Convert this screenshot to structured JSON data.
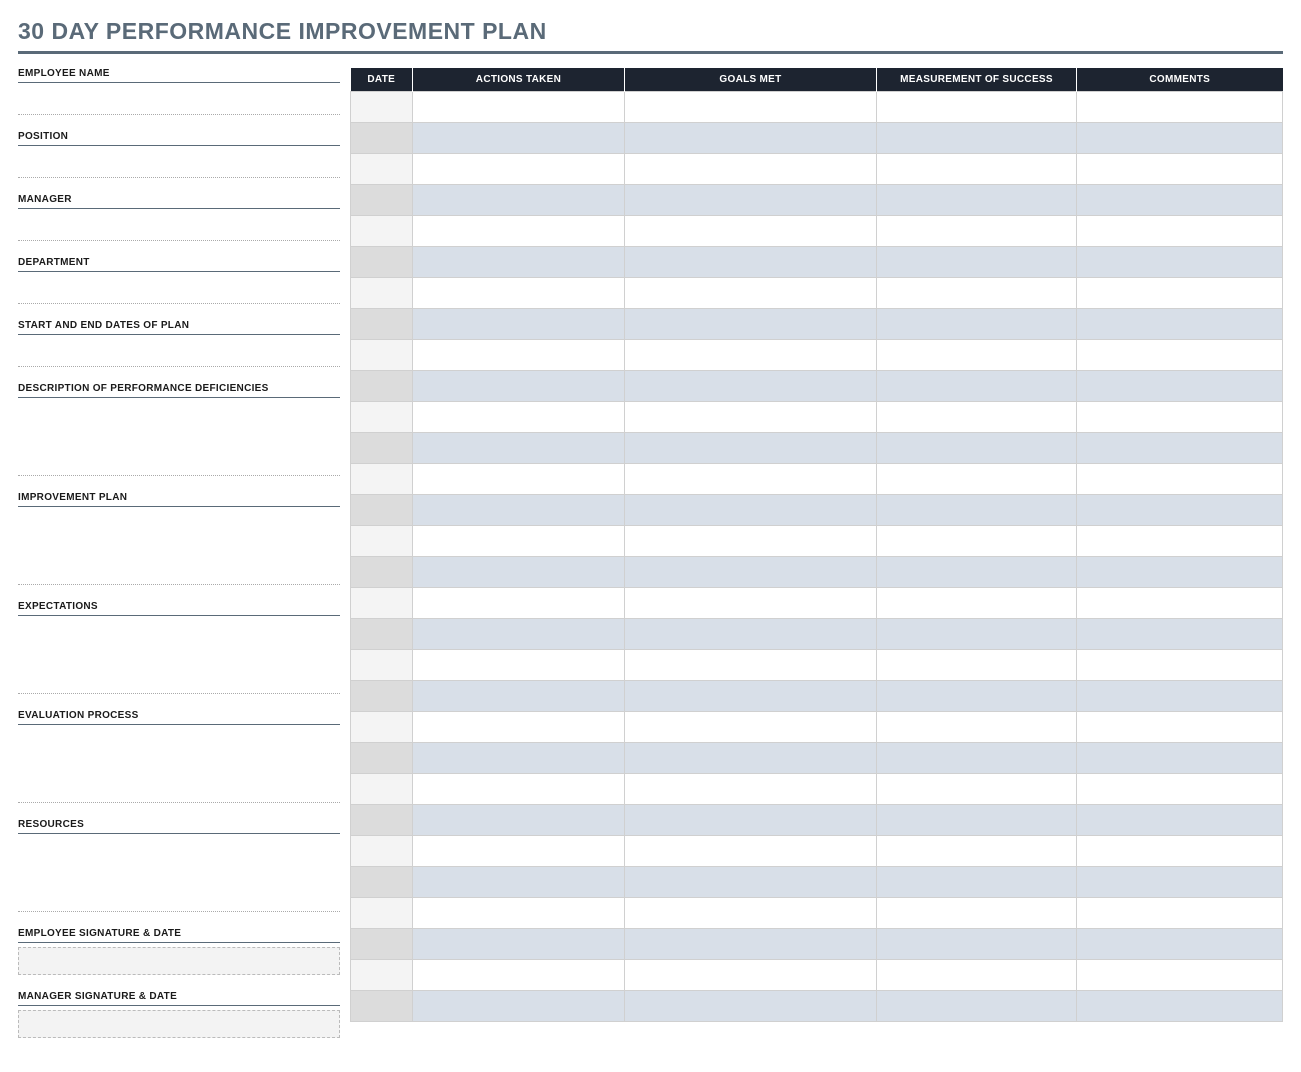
{
  "title": "30 DAY PERFORMANCE IMPROVEMENT PLAN",
  "left_fields": [
    {
      "label": "EMPLOYEE NAME",
      "type": "line"
    },
    {
      "label": "POSITION",
      "type": "line"
    },
    {
      "label": "MANAGER",
      "type": "line"
    },
    {
      "label": "DEPARTMENT",
      "type": "line"
    },
    {
      "label": "START AND END DATES OF PLAN",
      "type": "line"
    },
    {
      "label": "DESCRIPTION OF PERFORMANCE DEFICIENCIES",
      "type": "tall"
    },
    {
      "label": "IMPROVEMENT PLAN",
      "type": "tall"
    },
    {
      "label": "EXPECTATIONS",
      "type": "tall"
    },
    {
      "label": "EVALUATION PROCESS",
      "type": "tall"
    },
    {
      "label": "RESOURCES",
      "type": "tall"
    },
    {
      "label": "EMPLOYEE SIGNATURE & DATE",
      "type": "signature"
    },
    {
      "label": "MANAGER SIGNATURE & DATE",
      "type": "signature"
    }
  ],
  "table": {
    "headers": [
      "DATE",
      "ACTIONS TAKEN",
      "GOALS MET",
      "MEASUREMENT OF SUCCESS",
      "COMMENTS"
    ],
    "row_count": 30
  }
}
